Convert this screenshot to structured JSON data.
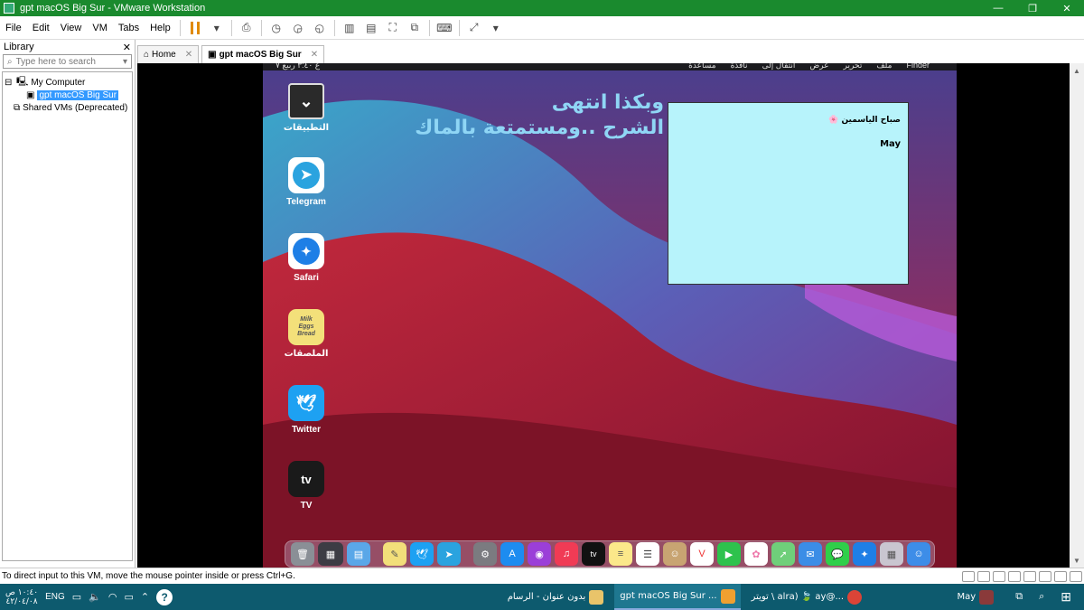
{
  "window": {
    "title": "gpt macOS Big Sur - VMware Workstation"
  },
  "menu": {
    "items": [
      "File",
      "Edit",
      "View",
      "VM",
      "Tabs",
      "Help"
    ]
  },
  "library": {
    "title": "Library",
    "search_placeholder": "Type here to search",
    "tree": {
      "my_computer": "My Computer",
      "vm": "gpt macOS Big Sur",
      "shared": "Shared VMs (Deprecated)"
    }
  },
  "tabs": {
    "home": "Home",
    "vm": "gpt macOS Big Sur"
  },
  "mac": {
    "menubar_items": [
      "Finder",
      "ملف",
      "تحرير",
      "عرض",
      "انتقال إلى",
      "نافذة",
      "مساعدة"
    ],
    "menubar_left": "ع ٣:٤٠ ربيع ٧",
    "title_line1": "وبكذا انتهى",
    "title_line2": "الشرح ..ومستمتعة بالماك",
    "note": {
      "line1": "صباح الياسمين 🌸",
      "line2": "May"
    },
    "desktop_icons": [
      {
        "label": "التطبيقات",
        "icon": "chevron-down"
      },
      {
        "label": "Telegram",
        "icon": "telegram"
      },
      {
        "label": "Safari",
        "icon": "safari"
      },
      {
        "label": "الملصقات",
        "icon": "stickies",
        "sticky_text": "Milk Eggs Bread"
      },
      {
        "label": "Twitter",
        "icon": "twitter"
      },
      {
        "label": "TV",
        "icon": "apple-tv",
        "badge_text": "tv"
      }
    ],
    "dock": {
      "left_icons": [
        "trash",
        "media-browser",
        "folder",
        "stickies",
        "twitter",
        "telegram"
      ],
      "right_icons": [
        "system-preferences",
        "app-store",
        "podcasts",
        "music",
        "apple-tv",
        "notes",
        "reminders",
        "contacts",
        "calendar",
        "facetime",
        "photos",
        "maps",
        "mail",
        "messages",
        "safari",
        "launchpad",
        "finder"
      ]
    }
  },
  "statusbar": {
    "hint": "To direct input to this VM, move the mouse pointer inside or press Ctrl+G."
  },
  "taskbar": {
    "clock_time": "١٠:٤٠ ص",
    "clock_date": "٤٢/٠٤/٠٨",
    "lang": "ENG",
    "apps": [
      {
        "label": "بدون عنوان - الرسام",
        "icon": "paint"
      },
      {
        "label": "gpt macOS Big Sur ...",
        "icon": "vmware"
      },
      {
        "label": "تويتر \\ alra) 🍃 ay@...",
        "icon": "chrome"
      }
    ],
    "right_label": "May"
  }
}
